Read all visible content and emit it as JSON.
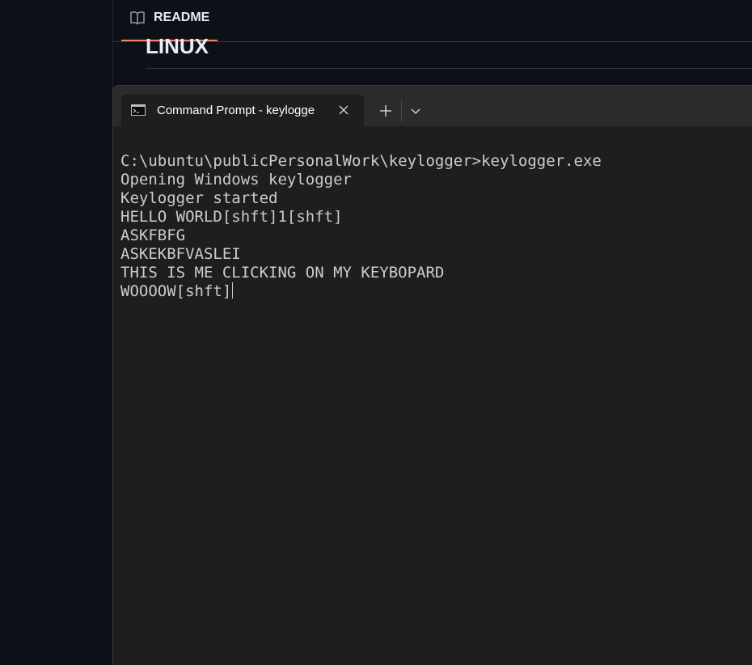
{
  "readme": {
    "tab_label": "README",
    "heading": "LINUX",
    "icon": "book-icon"
  },
  "terminal": {
    "tab_title": "Command Prompt - keylogge",
    "tab_icon": "cmd-icon",
    "close_icon": "close-icon",
    "new_tab_icon": "plus-icon",
    "dropdown_icon": "chevron-down-icon",
    "lines": [
      "C:\\ubuntu\\publicPersonalWork\\keylogger>keylogger.exe",
      "Opening Windows keylogger",
      "Keylogger started",
      "HELLO WORLD[shft]1[shft]",
      "ASKFBFG",
      "ASKEKBFVASLEI",
      "THIS IS ME CLICKING ON MY KEYBOPARD",
      "WOOOOW[shft]"
    ]
  },
  "colors": {
    "page_background": "#0d1117",
    "readme_accent": "#f78166",
    "terminal_background": "#1e1e1e",
    "title_bar": "#2b2b2b",
    "terminal_text": "#cccccc"
  }
}
